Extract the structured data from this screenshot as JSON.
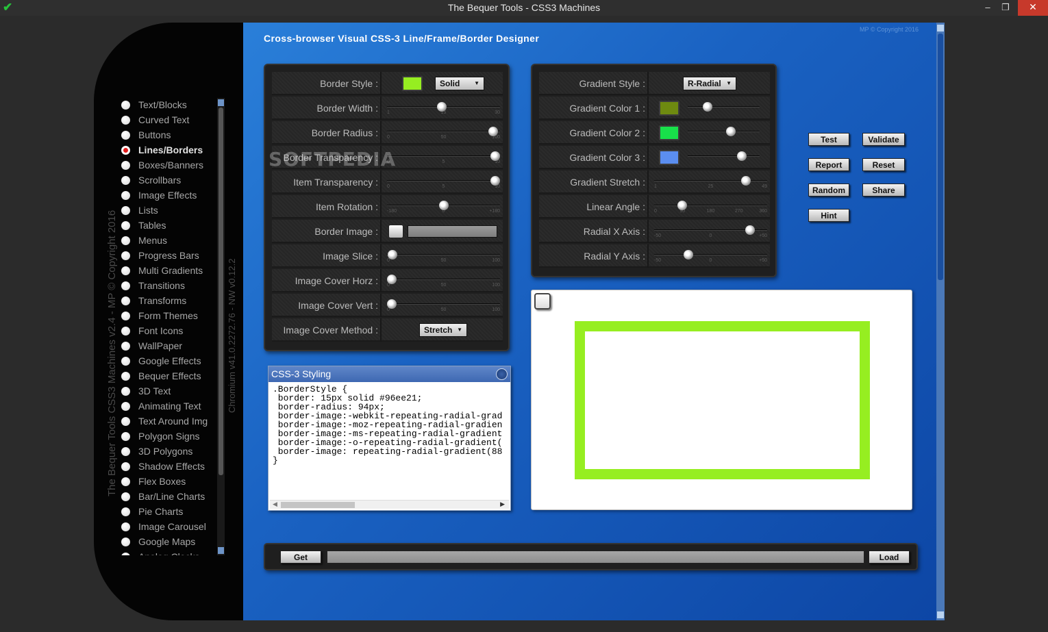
{
  "window": {
    "title": "The Bequer Tools - CSS3 Machines",
    "controls": {
      "minimize": "–",
      "maximize": "❐",
      "close": "✕"
    },
    "app_icon": "checkmark-icon",
    "app_icon_glyph": "✔"
  },
  "sidebar": {
    "vertical_title": "The Bequer Tools CSS3 Machines v2.4 - MP © Copyright 2016",
    "vertical_version": "Chromium v41.0.2272.76 - NW v0.12.2",
    "items": [
      "Text/Blocks",
      "Curved Text",
      "Buttons",
      "Lines/Borders",
      "Boxes/Banners",
      "Scrollbars",
      "Image Effects",
      "Lists",
      "Tables",
      "Menus",
      "Progress Bars",
      "Multi Gradients",
      "Transitions",
      "Transforms",
      "Form Themes",
      "Font Icons",
      "WallPaper",
      "Google Effects",
      "Bequer Effects",
      "3D Text",
      "Animating Text",
      "Text Around Img",
      "Polygon Signs",
      "3D Polygons",
      "Shadow Effects",
      "Flex Boxes",
      "Bar/Line Charts",
      "Pie Charts",
      "Image Carousel",
      "Google Maps",
      "Analog Clocks"
    ],
    "active_index": 3
  },
  "main": {
    "title": "Cross-browser Visual CSS-3 Line/Frame/Border Designer",
    "copyright": "MP © Copyright 2016",
    "watermark": "SOFTPEDIA"
  },
  "border_panel": {
    "border_style": {
      "label": "Border Style :",
      "color": "#96ee21",
      "value": "Solid"
    },
    "border_width": {
      "label": "Border Width :",
      "ticks": [
        "1",
        "15",
        "30"
      ],
      "value": 15,
      "min": 1,
      "max": 30
    },
    "border_radius": {
      "label": "Border Radius :",
      "ticks": [
        "0",
        "50",
        "100"
      ],
      "value": 94,
      "min": 0,
      "max": 100
    },
    "border_transparency": {
      "label": "Border Transparency :",
      "ticks": [
        "0",
        "5",
        "10"
      ],
      "value": 10,
      "min": 0,
      "max": 10
    },
    "item_transparency": {
      "label": "Item Transparency :",
      "ticks": [
        "0",
        "5",
        "10"
      ],
      "value": 10,
      "min": 0,
      "max": 10
    },
    "item_rotation": {
      "label": "Item Rotation :",
      "ticks": [
        "-180",
        "0",
        "+180"
      ],
      "value": 0,
      "min": -180,
      "max": 180
    },
    "border_image": {
      "label": "Border Image :"
    },
    "image_slice": {
      "label": "Image Slice :",
      "ticks": [
        "0",
        "50",
        "100"
      ],
      "value": 5,
      "min": 0,
      "max": 100
    },
    "image_cover_horz": {
      "label": "Image Cover Horz :",
      "ticks": [
        "0",
        "50",
        "100"
      ],
      "value": 0,
      "min": 0,
      "max": 100
    },
    "image_cover_vert": {
      "label": "Image Cover Vert :",
      "ticks": [
        "0",
        "50",
        "100"
      ],
      "value": 0,
      "min": 0,
      "max": 100
    },
    "image_cover_method": {
      "label": "Image Cover Method :",
      "value": "Stretch"
    }
  },
  "gradient_panel": {
    "gradient_style": {
      "label": "Gradient Style :",
      "value": "R-Radial"
    },
    "color1": {
      "label": "Gradient Color 1 :",
      "color": "#6e8a10",
      "level": 0.28
    },
    "color2": {
      "label": "Gradient Color 2 :",
      "color": "#18e04a",
      "level": 0.6
    },
    "color3": {
      "label": "Gradient Color 3 :",
      "color": "#5b8ef0",
      "level": 0.75
    },
    "gradient_stretch": {
      "label": "Gradient Stretch :",
      "ticks": [
        "1",
        "25",
        "49"
      ],
      "value": 40,
      "min": 1,
      "max": 49
    },
    "linear_angle": {
      "label": "Linear Angle :",
      "ticks": [
        "0",
        "90",
        "180",
        "270",
        "360"
      ],
      "value": 90,
      "min": 0,
      "max": 360
    },
    "radial_x": {
      "label": "Radial X Axis :",
      "ticks": [
        "-50",
        "0",
        "+50"
      ],
      "value": 35,
      "min": -50,
      "max": 50
    },
    "radial_y": {
      "label": "Radial Y Axis :",
      "ticks": [
        "-50",
        "0",
        "+50"
      ],
      "value": -20,
      "min": -50,
      "max": 50
    }
  },
  "actions": {
    "test": "Test",
    "validate": "Validate",
    "report": "Report",
    "reset": "Reset",
    "random": "Random",
    "share": "Share",
    "hint": "Hint"
  },
  "css_output": {
    "title": "CSS-3 Styling",
    "code": ".BorderStyle {\n border: 15px solid #96ee21;\n border-radius: 94px;\n border-image:-webkit-repeating-radial-grad\n border-image:-moz-repeating-radial-gradien\n border-image:-ms-repeating-radial-gradient\n border-image:-o-repeating-radial-gradient(\n border-image: repeating-radial-gradient(88\n}",
    "scroll_left": "◀",
    "scroll_right": "▶"
  },
  "bottom": {
    "get": "Get",
    "load": "Load",
    "url_value": ""
  }
}
